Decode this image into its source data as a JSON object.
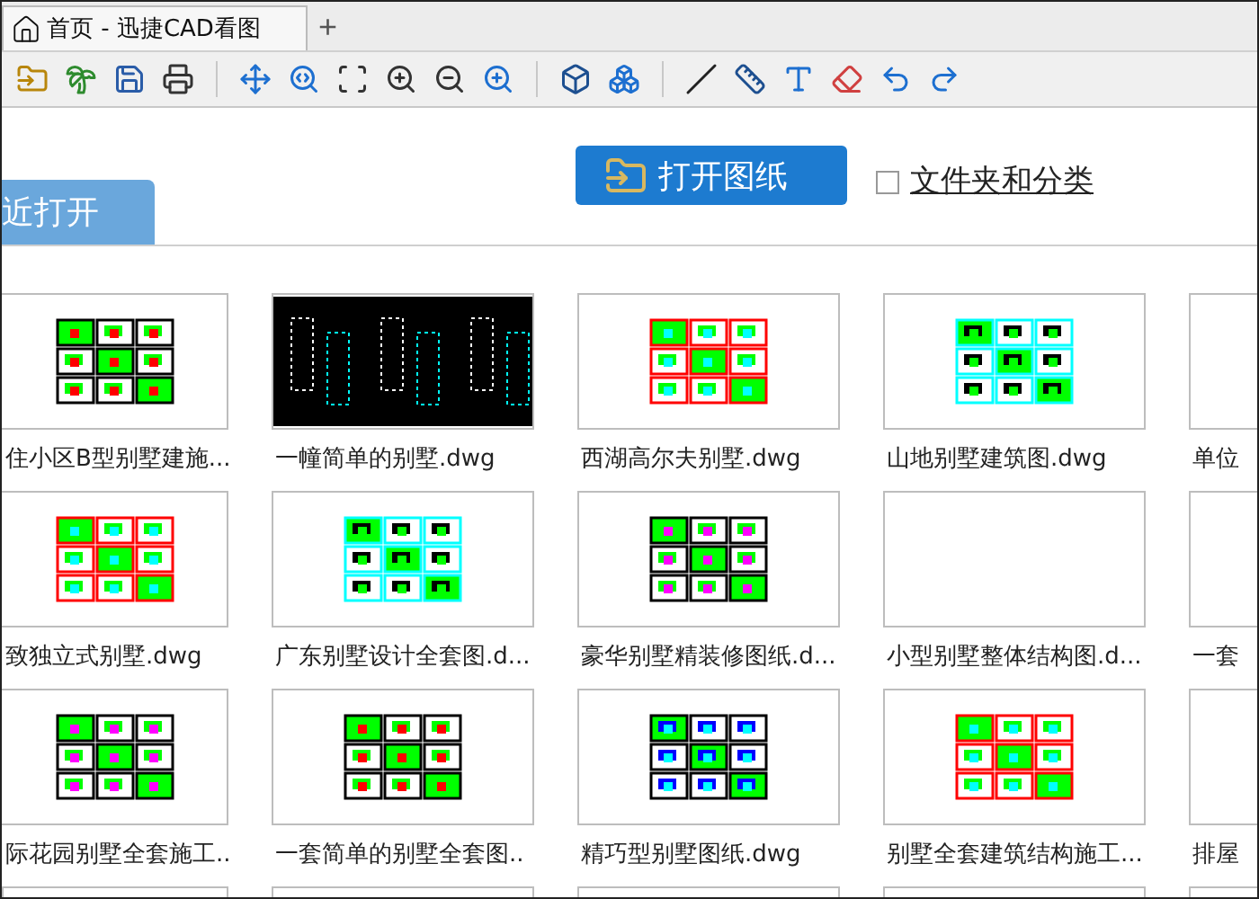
{
  "window": {
    "tab_title": "首页 - 迅捷CAD看图",
    "new_tab": "+"
  },
  "open_button": {
    "label": "打开图纸"
  },
  "folder_option": {
    "label": "文件夹和分类",
    "checked": false
  },
  "section_tab": {
    "label": "近打开"
  },
  "files": [
    [
      "住小区B型别墅建施...",
      "一幢简单的别墅.dwg",
      "西湖高尔夫别墅.dwg",
      "山地别墅建筑图.dwg",
      "单位"
    ],
    [
      "致独立式别墅.dwg",
      "广东别墅设计全套图.d...",
      "豪华别墅精装修图纸.d...",
      "小型别墅整体结构图.d...",
      "一套"
    ],
    [
      "际花园别墅全套施工..",
      "一套简单的别墅全套图..",
      "精巧型别墅图纸.dwg",
      "别墅全套建筑结构施工...",
      "排屋"
    ]
  ]
}
